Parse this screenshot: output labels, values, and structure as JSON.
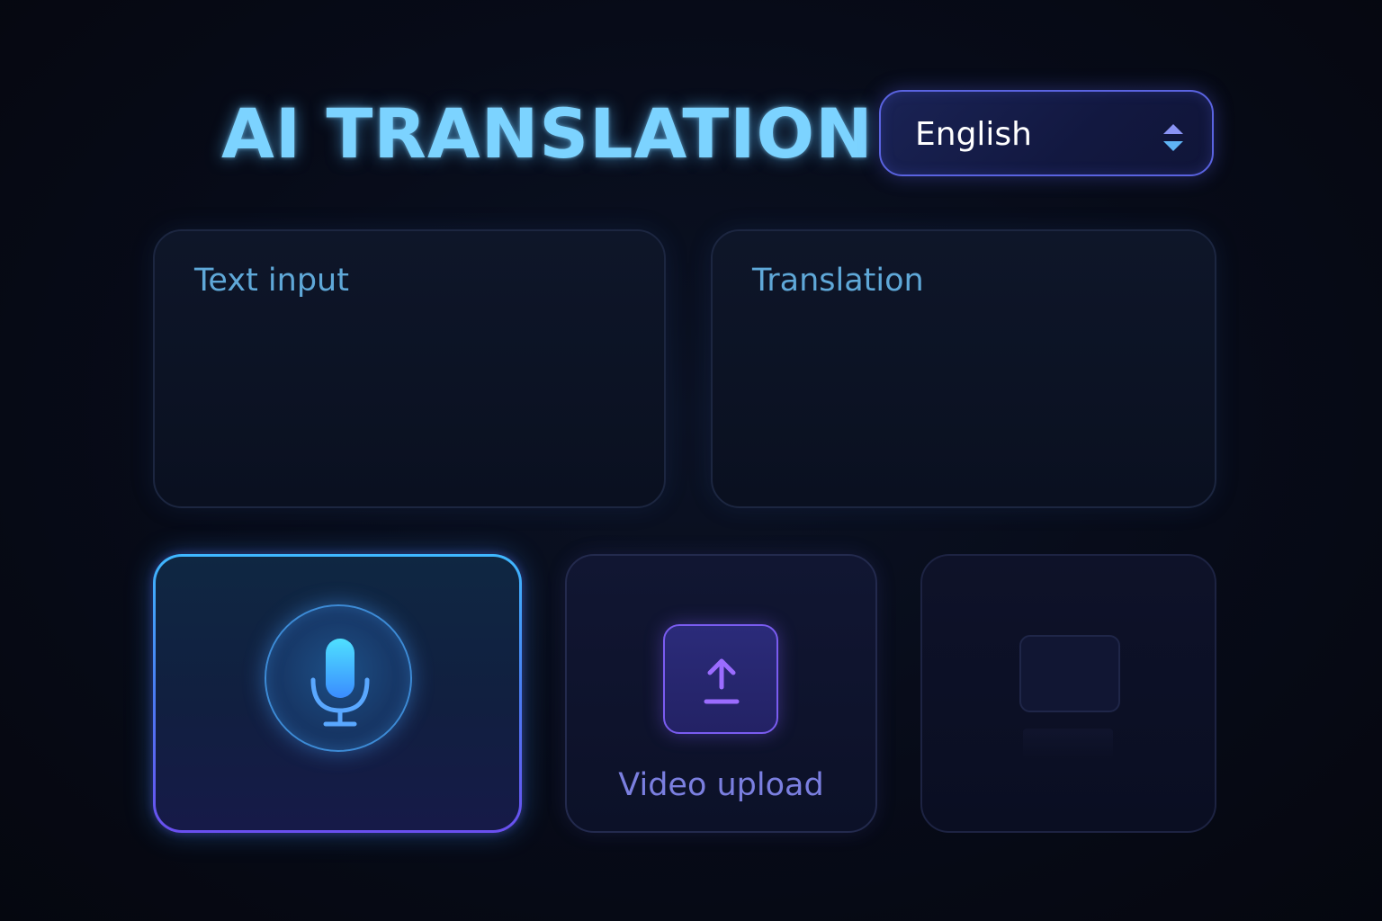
{
  "header": {
    "title": "AI TRANSLATION"
  },
  "language_select": {
    "selected": "English",
    "icon": "sort-arrows-icon"
  },
  "input_panel": {
    "placeholder": "Text input"
  },
  "output_panel": {
    "placeholder": "Translation"
  },
  "tiles": {
    "voice": {
      "icon": "microphone-icon",
      "active": true
    },
    "video": {
      "icon": "upload-icon",
      "label": "Video upload"
    },
    "placeholder": {
      "icon": "blank-frame-icon"
    }
  },
  "colors": {
    "title": "#7cd3ff",
    "accent_blue": "#3fb8ff",
    "accent_violet": "#6a4ff0",
    "background": "#070b18"
  }
}
